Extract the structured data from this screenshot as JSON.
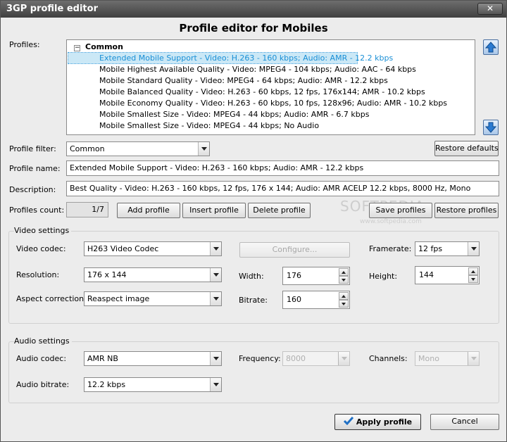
{
  "window": {
    "title": "3GP profile editor",
    "close_glyph": "✕"
  },
  "heading": "Profile editor for Mobiles",
  "profiles": {
    "label": "Profiles:",
    "group_name": "Common",
    "toggle_glyph": "−",
    "items": [
      "Extended Mobile Support - Video: H.263 - 160 kbps; Audio: AMR - 12.2 kbps",
      "Mobile Highest Available Quality - Video: MPEG4 - 104 kbps; Audio: AAC - 64 kbps",
      "Mobile Standard Quality - Video: MPEG4 - 64 kbps; Audio: AMR - 12.2 kbps",
      "Mobile Balanced Quality - Video: H.263 - 60 kbps, 12 fps, 176x144; AMR - 10.2 kbps",
      "Mobile Economy Quality - Video: H.263 - 60 kbps, 10 fps, 128x96; Audio: AMR - 10.2 kbps",
      "Mobile Smallest Size - Video: MPEG4 - 44 kbps; Audio: AMR - 6.7 kbps",
      "Mobile Smallest Size - Video: MPEG4 - 44 kbps; No Audio"
    ],
    "selected_index": 0,
    "move_up_icon": "arrow-up-icon",
    "move_down_icon": "arrow-down-icon"
  },
  "filter": {
    "label": "Profile filter:",
    "value": "Common",
    "restore_defaults": "Restore defaults"
  },
  "name": {
    "label": "Profile name:",
    "value": "Extended Mobile Support - Video: H.263 - 160 kbps; Audio: AMR - 12.2 kbps"
  },
  "description": {
    "label": "Description:",
    "value": "Best Quality - Video: H.263 - 160 kbps, 12 fps, 176 x 144; Audio: AMR ACELP 12.2 kbps, 8000 Hz, Mono"
  },
  "count": {
    "label": "Profiles count:",
    "value": "1/7",
    "add": "Add profile",
    "insert": "Insert profile",
    "delete": "Delete profile",
    "save": "Save profiles",
    "restore": "Restore profiles"
  },
  "video": {
    "title": "Video settings",
    "codec_label": "Video codec:",
    "codec": "H263 Video Codec",
    "configure": "Configure...",
    "framerate_label": "Framerate:",
    "framerate": "12 fps",
    "resolution_label": "Resolution:",
    "resolution": "176 x 144",
    "width_label": "Width:",
    "width": "176",
    "height_label": "Height:",
    "height": "144",
    "aspect_label": "Aspect correction:",
    "aspect": "Reaspect image",
    "bitrate_label": "Bitrate:",
    "bitrate": "160"
  },
  "audio": {
    "title": "Audio settings",
    "codec_label": "Audio codec:",
    "codec": "AMR NB",
    "frequency_label": "Frequency:",
    "frequency": "8000",
    "channels_label": "Channels:",
    "channels": "Mono",
    "bitrate_label": "Audio bitrate:",
    "bitrate": "12.2 kbps"
  },
  "footer": {
    "apply": "Apply profile",
    "cancel": "Cancel",
    "apply_icon": "checkmark-icon"
  },
  "watermark": {
    "main": "SOFTPEDIA",
    "sub": "www.softpedia.com"
  },
  "colors": {
    "selection_text": "#1a8fd6",
    "selection_bg": "#cbe8f6",
    "arrow_blue": "#2b7ad1",
    "check_blue": "#1f6fc4"
  }
}
